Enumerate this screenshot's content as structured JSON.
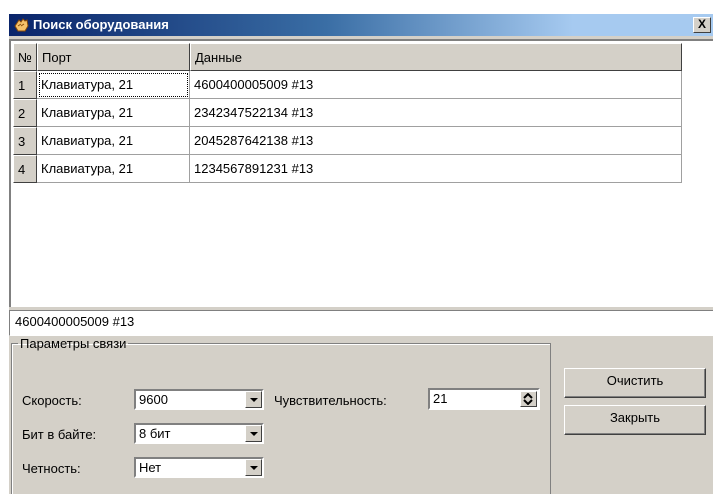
{
  "window": {
    "title": "Поиск оборудования",
    "close_label": "X"
  },
  "grid": {
    "headers": [
      "№",
      "Порт",
      "Данные"
    ],
    "rows": [
      {
        "num": "1",
        "port": "Клавиатура, 21",
        "data": "4600400005009 #13"
      },
      {
        "num": "2",
        "port": "Клавиатура, 21",
        "data": "2342347522134 #13"
      },
      {
        "num": "3",
        "port": "Клавиатура, 21",
        "data": "2045287642138 #13"
      },
      {
        "num": "4",
        "port": "Клавиатура, 21",
        "data": "1234567891231 #13"
      }
    ]
  },
  "selected_value": "4600400005009 #13",
  "params": {
    "legend": "Параметры связи",
    "speed_label": "Скорость:",
    "speed_value": "9600",
    "bits_label": "Бит в байте:",
    "bits_value": "8 бит",
    "parity_label": "Четность:",
    "parity_value": "Нет",
    "sensitivity_label": "Чувствительность:",
    "sensitivity_value": "21"
  },
  "buttons": {
    "clear": "Очистить",
    "close": "Закрыть"
  }
}
